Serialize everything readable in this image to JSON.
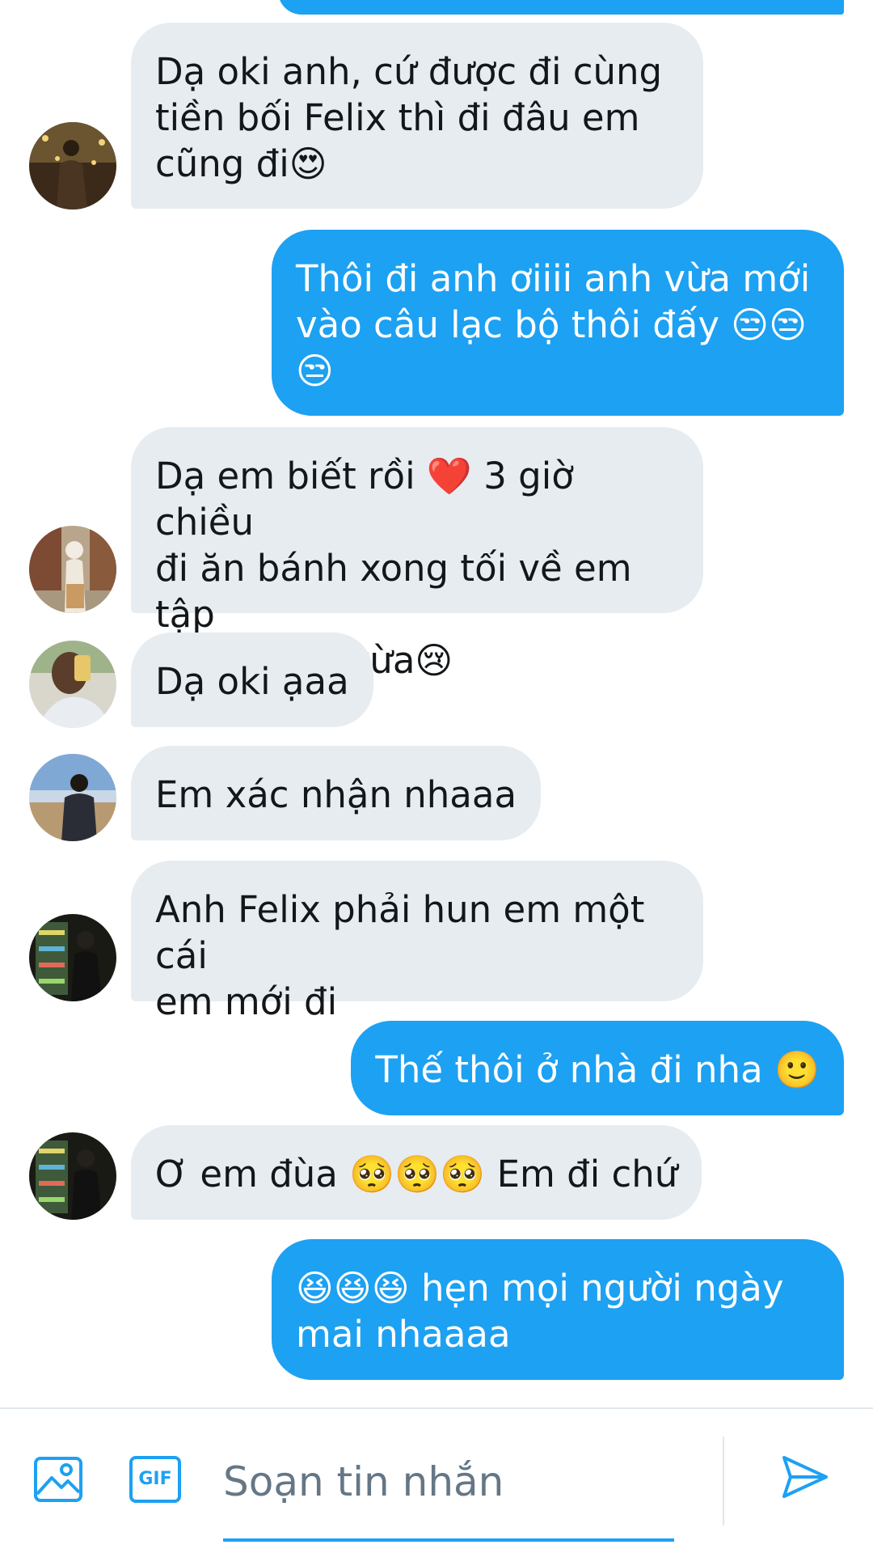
{
  "conversation": {
    "messages": [
      {
        "side": "out",
        "text": ""
      },
      {
        "side": "in",
        "text": "Dạ oki anh, cứ được đi cùng\ntiền bối Felix thì đi đâu em\ncũng đi😍",
        "avatar": "avatar-brown-coat-city"
      },
      {
        "side": "out",
        "text": "Thôi đi anh ơiiii anh vừa mới\nvào câu lạc bộ thôi đấy 😒😒\n😒"
      },
      {
        "side": "in",
        "text": "Dạ em biết rồi ❤️ 3 giờ chiều\nđi ăn bánh xong tối về em tập\nthể dục là vừa😢",
        "avatar": "avatar-white-hat-girl"
      },
      {
        "side": "in",
        "text": "Dạ oki ạaa",
        "avatar": "avatar-mirror-selfie"
      },
      {
        "side": "in",
        "text": "Em xác nhận nhaaa",
        "avatar": "avatar-beach-boy"
      },
      {
        "side": "in",
        "text": "Anh Felix phải hun em một cái\nem mới đi",
        "avatar": "avatar-store-fridge"
      },
      {
        "side": "out",
        "text": "Thế thôi ở nhà đi nha 🙂"
      },
      {
        "side": "in",
        "text": "Ơ em đùa 🥺🥺🥺 Em đi chứ",
        "avatar": "avatar-store-fridge"
      },
      {
        "side": "out",
        "text": "😆😆😆 hẹn mọi người ngày\nmai nhaaaa"
      }
    ]
  },
  "composer": {
    "placeholder": "Soạn tin nhắn",
    "gif_label": "GIF",
    "icons": {
      "image": "image-icon",
      "send": "send-icon"
    }
  },
  "colors": {
    "accent": "#1da1f2",
    "incoming_bubble": "#e6ecf0",
    "text": "#14171a",
    "placeholder": "#657786"
  }
}
